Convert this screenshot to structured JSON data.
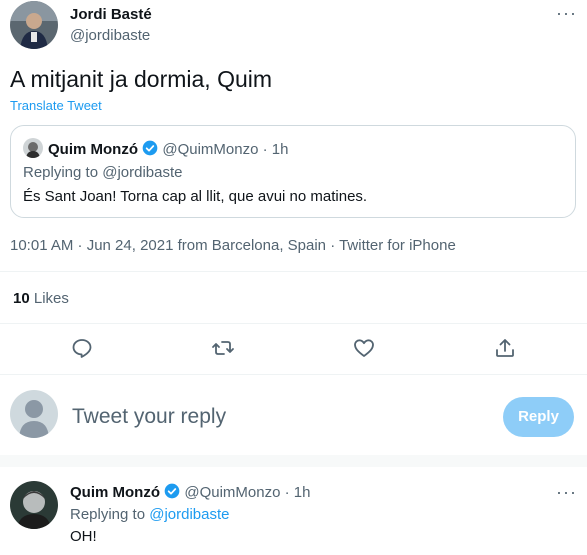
{
  "tweet": {
    "author_name": "Jordi Basté",
    "author_handle": "@jordibaste",
    "text": "A mitjanit ja dormia, Quim",
    "translate_label": "Translate Tweet",
    "timestamp": "10:01 AM · Jun 24, 2021 from Barcelona, Spain · Twitter for iPhone",
    "likes_count": "10",
    "likes_label": "Likes"
  },
  "quoted_tweet": {
    "author_name": "Quim Monzó",
    "author_handle": "@QuimMonzo",
    "time": "· 1h",
    "replying_to": "Replying to @jordibaste",
    "text": "És Sant Joan! Torna cap al llit, que avui no matines."
  },
  "compose": {
    "placeholder": "Tweet your reply",
    "reply_button": "Reply"
  },
  "reply_tweet": {
    "author_name": "Quim Monzó",
    "author_handle": "@QuimMonzo",
    "time": "· 1h",
    "replying_to_prefix": "Replying to",
    "replying_to_handle": "@jordibaste",
    "text": "OH!"
  },
  "more_icon": "···",
  "icons": [
    "reply-icon",
    "retweet-icon",
    "like-icon",
    "share-icon",
    "more-icon",
    "verified-icon"
  ],
  "colors": {
    "accent": "#1d9bf0",
    "reply_button_disabled": "#8ecdf8",
    "muted": "#536471"
  }
}
